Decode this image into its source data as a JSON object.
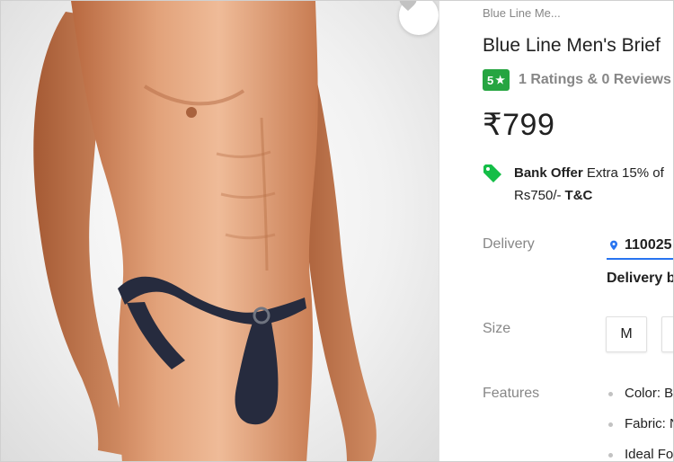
{
  "product": {
    "breadcrumb": "Blue Line Me...",
    "title": "Blue Line Men's Brief",
    "rating_value": "5",
    "rating_star": "★",
    "rating_summary": "1 Ratings & 0 Reviews",
    "price": "₹799"
  },
  "offer": {
    "icon": "tag-icon",
    "title": "Bank Offer",
    "text_line1": " Extra 15% of",
    "text_line2": "Rs750/-",
    "tnc": "T&C"
  },
  "delivery": {
    "label": "Delivery",
    "pincode": "110025",
    "delivery_by": "Delivery by"
  },
  "size": {
    "label": "Size",
    "options": [
      "M",
      ""
    ]
  },
  "features": {
    "label": "Features",
    "items": [
      "Color: Blue",
      "Fabric: Nylon",
      "Ideal For: Men"
    ]
  },
  "icons": {
    "wishlist": "heart-icon",
    "location": "location-pin-icon"
  },
  "colors": {
    "rating_green": "#26a541",
    "link_blue": "#2874f0",
    "offer_green": "#14be47",
    "muted_gray": "#878787",
    "product_navy": "#262b3e"
  }
}
